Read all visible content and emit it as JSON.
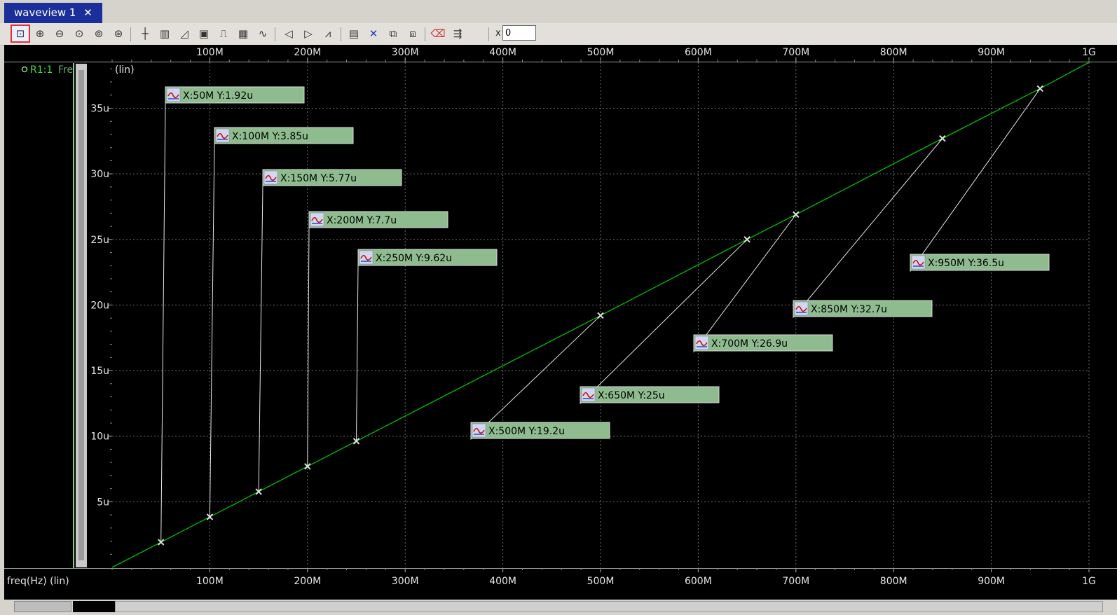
{
  "window": {
    "tab_title": "waveview 1",
    "tab_close": "✕"
  },
  "toolbar": {
    "x_label": "x",
    "x_value": "0",
    "icons": [
      "zoom-fit-icon",
      "zoom-in-icon",
      "zoom-out-icon",
      "zoom-box-icon",
      "zoom-x-icon",
      "zoom-y-icon",
      "cursor-icon",
      "bar-cursor-icon",
      "measure-icon",
      "label-icon",
      "pulse-icon",
      "grid-icon",
      "wave-icon",
      "prev-icon",
      "next-icon",
      "marker-icon",
      "fit-icon",
      "delete-icon",
      "copy-icon",
      "paste-icon",
      "eraser-icon",
      "export-icon"
    ]
  },
  "panel": {
    "signal_label": "R1:1",
    "signal_name": "Fre",
    "y_scale": "(lin)"
  },
  "x_axis_footer": "freq(Hz) (lin)",
  "colors": {
    "trace": "#00c000",
    "label_bg": "#8fbc8f",
    "grid": "#707070",
    "axis_text": "#e6e6e6"
  },
  "chart_data": {
    "type": "line",
    "x": [
      0,
      50,
      100,
      150,
      200,
      250,
      500,
      650,
      700,
      850,
      950,
      1000
    ],
    "x_unit": "MHz",
    "y": [
      0,
      1.92,
      3.85,
      5.77,
      7.7,
      9.62,
      19.2,
      25,
      26.9,
      32.7,
      36.5,
      38.5
    ],
    "y_unit": "u",
    "xlim": [
      0,
      1000
    ],
    "ylim": [
      0,
      38.5
    ],
    "x_ticks": [
      "100M",
      "200M",
      "300M",
      "400M",
      "500M",
      "600M",
      "700M",
      "800M",
      "900M",
      "1G"
    ],
    "y_ticks": [
      "5u",
      "10u",
      "15u",
      "20u",
      "25u",
      "30u",
      "35u"
    ],
    "grid": true,
    "markers": [
      {
        "x": 50,
        "y": 1.92,
        "label": "X:50M Y:1.92u"
      },
      {
        "x": 100,
        "y": 3.85,
        "label": "X:100M Y:3.85u"
      },
      {
        "x": 150,
        "y": 5.77,
        "label": "X:150M Y:5.77u"
      },
      {
        "x": 200,
        "y": 7.7,
        "label": "X:200M Y:7.7u"
      },
      {
        "x": 250,
        "y": 9.62,
        "label": "X:250M Y:9.62u"
      },
      {
        "x": 500,
        "y": 19.2,
        "label": "X:500M Y:19.2u"
      },
      {
        "x": 650,
        "y": 25,
        "label": "X:650M Y:25u"
      },
      {
        "x": 700,
        "y": 26.9,
        "label": "X:700M Y:26.9u"
      },
      {
        "x": 850,
        "y": 32.7,
        "label": "X:850M Y:32.7u"
      },
      {
        "x": 950,
        "y": 36.5,
        "label": "X:950M Y:36.5u"
      }
    ]
  }
}
